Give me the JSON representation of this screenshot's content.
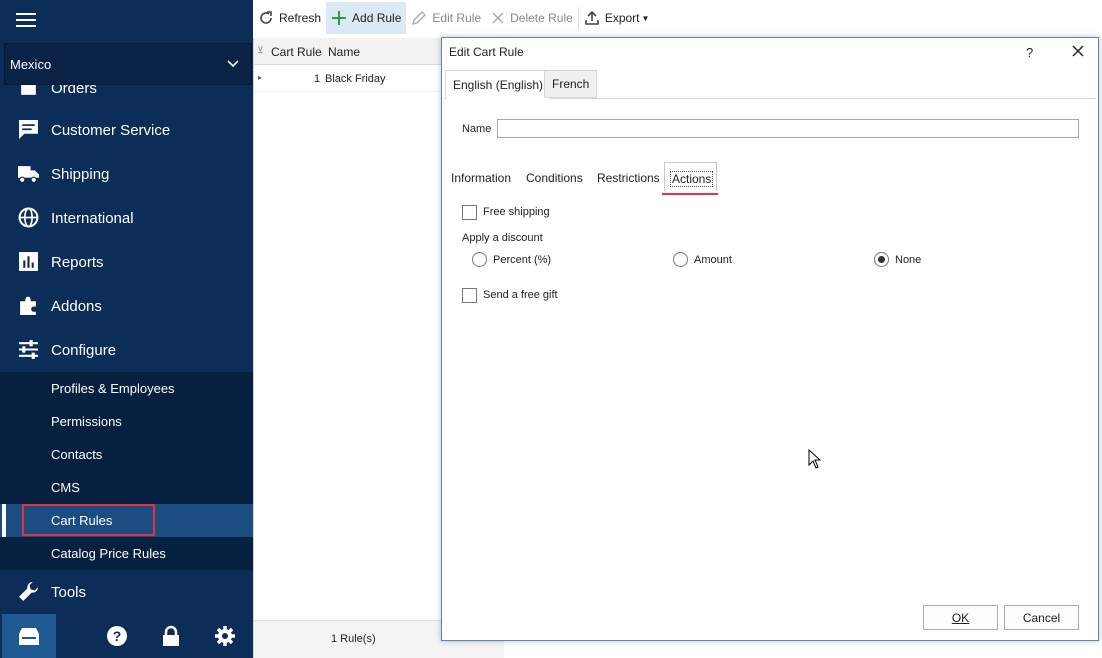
{
  "sidebar": {
    "store": "Mexico",
    "nav_items": [
      {
        "label": "Orders",
        "icon": "orders-icon"
      },
      {
        "label": "Customer Service",
        "icon": "chat-icon"
      },
      {
        "label": "Shipping",
        "icon": "truck-icon"
      },
      {
        "label": "International",
        "icon": "globe-icon"
      },
      {
        "label": "Reports",
        "icon": "bar-chart-icon"
      },
      {
        "label": "Addons",
        "icon": "puzzle-icon"
      },
      {
        "label": "Configure",
        "icon": "sliders-icon"
      }
    ],
    "submenu": [
      {
        "label": "Profiles & Employees"
      },
      {
        "label": "Permissions"
      },
      {
        "label": "Contacts"
      },
      {
        "label": "CMS"
      },
      {
        "label": "Cart Rules",
        "active": true
      },
      {
        "label": "Catalog Price Rules"
      }
    ],
    "tools": {
      "label": "Tools",
      "icon": "wrench-icon"
    },
    "bottom_icons": [
      "store-icon",
      "help-icon",
      "lock-icon",
      "gear-icon"
    ]
  },
  "toolbar": {
    "refresh": "Refresh",
    "add_rule": "Add Rule",
    "edit_rule": "Edit Rule",
    "delete_rule": "Delete Rule",
    "export": "Export"
  },
  "grid": {
    "columns": [
      "Cart Rule",
      "Name"
    ],
    "rows": [
      {
        "id": "1",
        "name": "Black Friday"
      }
    ],
    "footer": "1 Rule(s)"
  },
  "dialog": {
    "title": "Edit Cart Rule",
    "help": "?",
    "language_tabs": [
      {
        "label": "English (English)",
        "active": true
      },
      {
        "label": "French",
        "active": false
      }
    ],
    "name_label": "Name",
    "name_value": "",
    "tabs": [
      "Information",
      "Conditions",
      "Restrictions",
      "Actions"
    ],
    "active_tab": "Actions",
    "free_shipping": {
      "label": "Free shipping",
      "checked": false
    },
    "discount_label": "Apply a discount",
    "discount_options": [
      {
        "label": "Percent (%)",
        "checked": false
      },
      {
        "label": "Amount",
        "checked": false
      },
      {
        "label": "None",
        "checked": true
      }
    ],
    "free_gift": {
      "label": "Send a free gift",
      "checked": false
    },
    "ok": "OK",
    "cancel": "Cancel"
  },
  "colors": {
    "sidebar_bg": "#0c2d57",
    "submenu_bg": "#06203f",
    "active_item": "#1c4d80",
    "highlight": "#e8303a",
    "add_icon": "#2e9e3a"
  }
}
